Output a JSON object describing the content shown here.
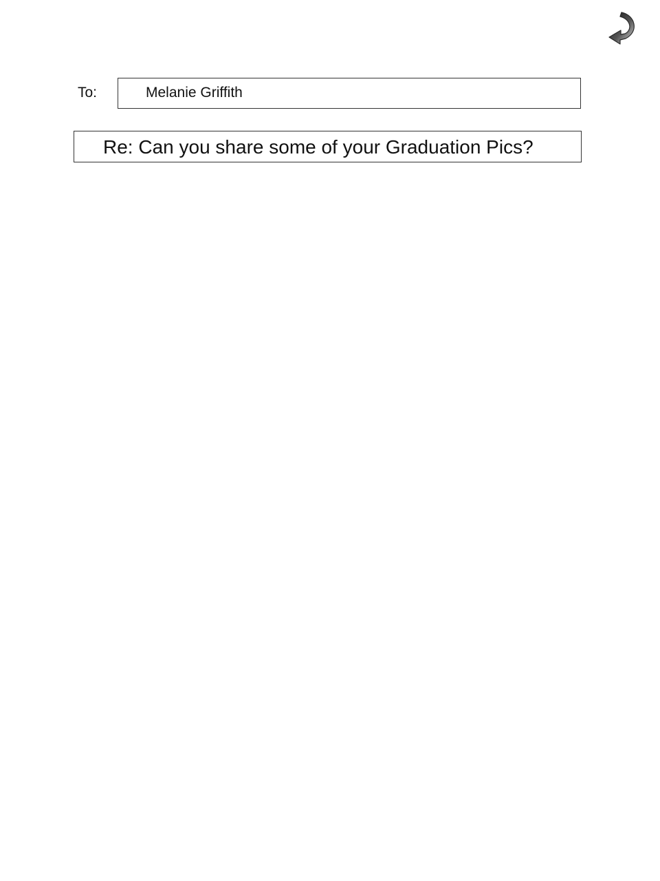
{
  "reply_button": {
    "icon": "reply-arrow-icon"
  },
  "to": {
    "label": "To:",
    "value": "Melanie Griffith"
  },
  "subject": {
    "value": "Re: Can you share some of your Graduation Pics?"
  },
  "colors": {
    "border": "#333333",
    "text": "#111111",
    "icon_dark": "#3a3a3a",
    "icon_light": "#d8d8d8"
  }
}
